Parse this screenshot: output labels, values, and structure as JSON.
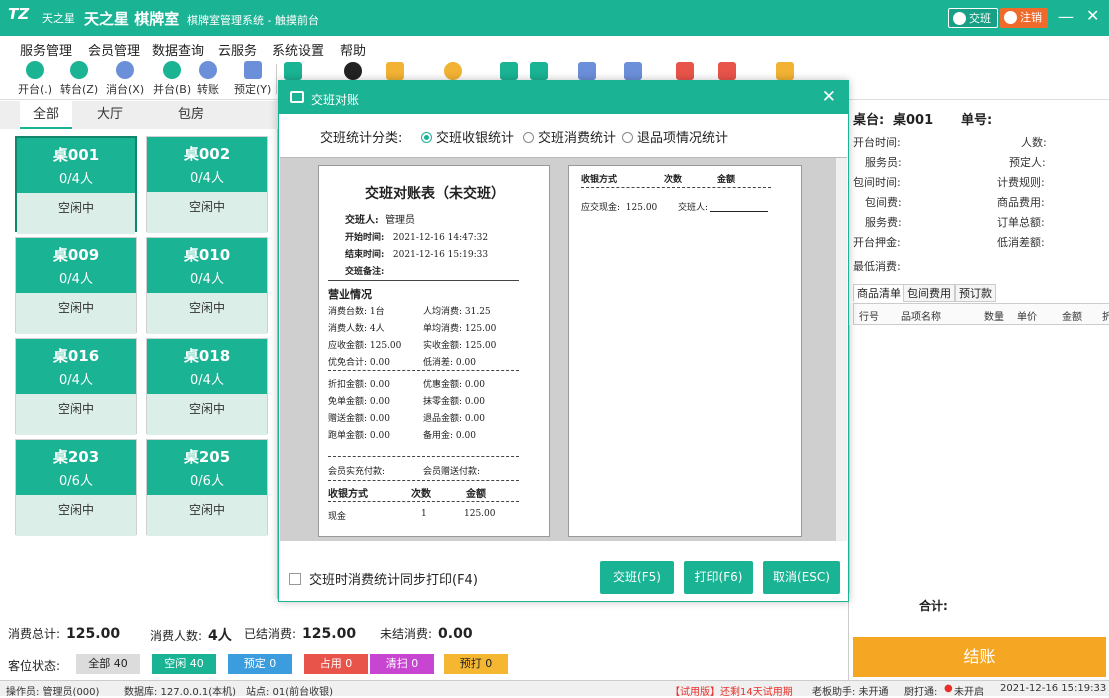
{
  "app": {
    "logo": "TZ",
    "logo_small": "天之星",
    "name": "天之星 棋牌室",
    "subtitle": "棋牌室管理系统 - 触摸前台",
    "handover_btn": "交班",
    "logout_btn": "注销",
    "min": "—",
    "close": "✕"
  },
  "menu": [
    "服务管理",
    "会员管理",
    "数据查询",
    "云服务",
    "系统设置",
    "帮助"
  ],
  "toolbar": [
    "开台(.)",
    "转台(Z)",
    "消台(X)",
    "并台(B)",
    "转账",
    "预定(Y)"
  ],
  "tabs": [
    "全部",
    "大厅",
    "包房"
  ],
  "cards": [
    {
      "name": "桌001",
      "count": "0/4人",
      "status": "空闲中"
    },
    {
      "name": "桌002",
      "count": "0/4人",
      "status": "空闲中"
    },
    {
      "name": "桌009",
      "count": "0/4人",
      "status": "空闲中"
    },
    {
      "name": "桌010",
      "count": "0/4人",
      "status": "空闲中"
    },
    {
      "name": "桌016",
      "count": "0/4人",
      "status": "空闲中"
    },
    {
      "name": "桌018",
      "count": "0/4人",
      "status": "空闲中"
    },
    {
      "name": "桌203",
      "count": "0/6人",
      "status": "空闲中"
    },
    {
      "name": "桌205",
      "count": "0/6人",
      "status": "空闲中"
    }
  ],
  "summary": {
    "total_label": "消费总计:",
    "total": "125.00",
    "people_label": "消费人数:",
    "people": "4人",
    "done_label": "已结消费:",
    "done": "125.00",
    "pending_label": "未结消费:",
    "pending": "0.00"
  },
  "status_bar": {
    "label": "客位状态:",
    "items": [
      {
        "text": "全部 40",
        "color": "#dcdcdc"
      },
      {
        "text": "空闲 40",
        "color": "#1ab394"
      },
      {
        "text": "预定 0",
        "color": "#3b9ddd"
      },
      {
        "text": "占用 0",
        "color": "#e8534a"
      },
      {
        "text": "清扫 0",
        "color": "#c845d2"
      },
      {
        "text": "预打 0",
        "color": "#f5b731"
      }
    ]
  },
  "footer": {
    "operator": "操作员: 管理员(000)",
    "db": "数据库: 127.0.0.1(本机)",
    "site": "站点: 01(前台收银)",
    "trial": "【试用版】还剩14天试用期",
    "boss": "老板助手: 未开通",
    "kitchen_label": "厨打通:",
    "kitchen": "未开启",
    "datetime": "2021-12-16 15:19:33"
  },
  "right": {
    "table_label": "桌台:",
    "table": "桌001",
    "order_label": "单号:",
    "fields": [
      "开台时间:",
      "人数:",
      "服务员:",
      "预定人:",
      "包间时间:",
      "计费规则:",
      "包间费:",
      "商品费用:",
      "服务费:",
      "订单总额:",
      "开台押金:",
      "低消差额:",
      "最低消费:"
    ],
    "tabs": [
      "商品清单",
      "包间费用",
      "预订款"
    ],
    "cols": [
      "行号",
      "品项名称",
      "数量",
      "单价",
      "金额",
      "折"
    ],
    "total_label": "合计:",
    "checkout": "结账"
  },
  "dialog": {
    "title": "交班对账",
    "cat_label": "交班统计分类:",
    "options": [
      "交班收银统计",
      "交班消费统计",
      "退品项情况统计"
    ],
    "sync_print": "交班时消费统计同步打印(F4)",
    "btn_handover": "交班(F5)",
    "btn_print": "打印(F6)",
    "btn_cancel": "取消(ESC)"
  },
  "receipt": {
    "title": "交班对账表（未交班）",
    "handover_person_label": "交班人:",
    "handover_person": "管理员",
    "start_label": "开始时间:",
    "start": "2021-12-16 14:47:32",
    "end_label": "结束时间:",
    "end": "2021-12-16 15:19:33",
    "note_label": "交班备注:",
    "biz_title": "营业情况",
    "r1": "消费台数:   1台",
    "r1b": "人均消费:   31.25",
    "r2": "消费人数:   4人",
    "r2b": "单均消费:   125.00",
    "r3": "应收金额:   125.00",
    "r3b": "实收金额:   125.00",
    "r4": "优免合计:   0.00",
    "r4b": "低消差:   0.00",
    "r5": "折扣金额:   0.00",
    "r5b": "优惠金额:   0.00",
    "r6": "免单金额:   0.00",
    "r6b": "抹零金额:   0.00",
    "r7": "赠送金额:   0.00",
    "r7b": "退品金额:   0.00",
    "r8": "跑单金额:   0.00",
    "r8b": "备用金:   0.00",
    "member_recharge": "会员实充付款:",
    "member_gift": "会员赠送付款:",
    "pay_head": "收银方式",
    "count_head": "次数",
    "amount_head": "金额",
    "pay_cash": "现金",
    "pay_cash_count": "1",
    "pay_cash_amount": "125.00",
    "p2_head_method": "收银方式",
    "p2_head_count": "次数",
    "p2_head_amount": "金额",
    "p2_cash_label": "应交现金:",
    "p2_cash": "125.00",
    "p2_handover_label": "交班人:"
  }
}
